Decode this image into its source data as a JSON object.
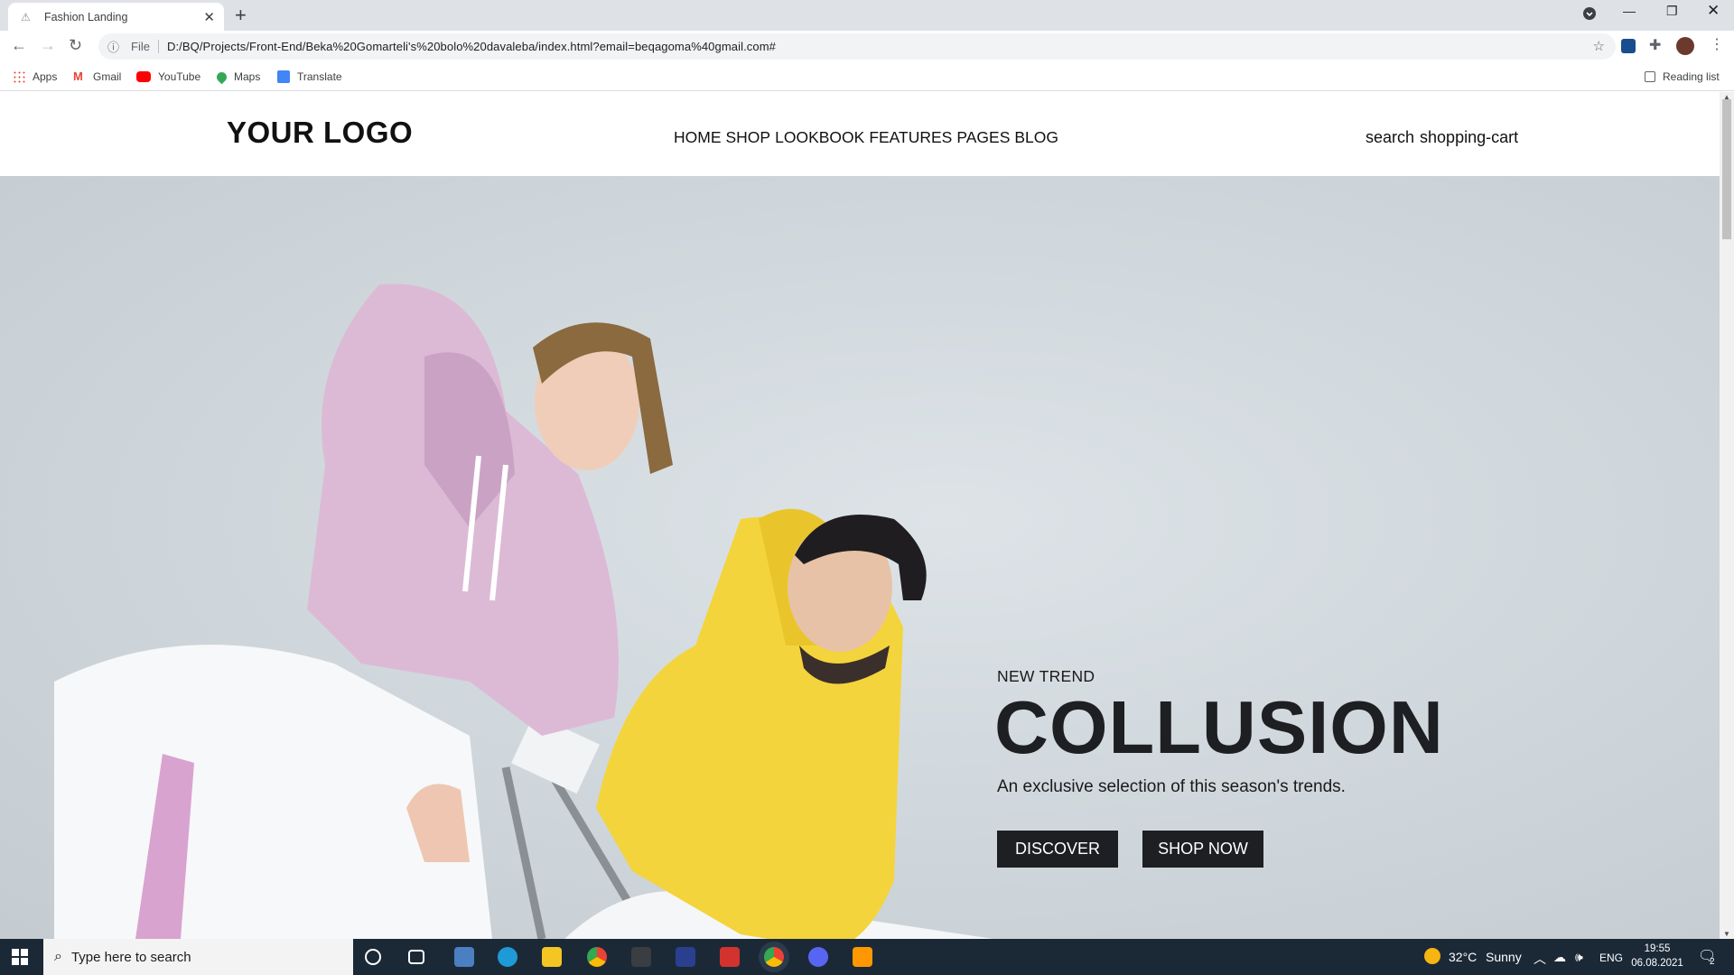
{
  "browser": {
    "tab_title": "Fashion Landing",
    "file_label": "File",
    "url": "D:/BQ/Projects/Front-End/Beka%20Gomarteli's%20bolo%20davaleba/index.html?email=beqagoma%40gmail.com#",
    "bookmarks": [
      "Apps",
      "Gmail",
      "YouTube",
      "Maps",
      "Translate"
    ],
    "reading_list": "Reading list"
  },
  "site": {
    "logo": "YOUR LOGO",
    "nav": [
      "HOME",
      "SHOP",
      "LOOKBOOK",
      "FEATURES",
      "PAGES",
      "BLOG"
    ],
    "actions": [
      "search",
      "shopping-cart"
    ]
  },
  "hero": {
    "eyebrow": "NEW TREND",
    "title": "COLLUSION",
    "subtitle": "An exclusive selection of this season's trends.",
    "buttons": [
      "DISCOVER",
      "SHOP NOW"
    ]
  },
  "taskbar": {
    "search_placeholder": "Type here to search",
    "weather_temp": "32°C",
    "weather_desc": "Sunny",
    "lang": "ENG",
    "time": "19:55",
    "date": "06.08.2021",
    "notification_count": "2"
  },
  "colors": {
    "hero_bg": "#cdd5da",
    "button_bg": "#1d1f22",
    "pink_hoodie": "#d8b7d3",
    "yellow_hoodie": "#f3d437"
  }
}
